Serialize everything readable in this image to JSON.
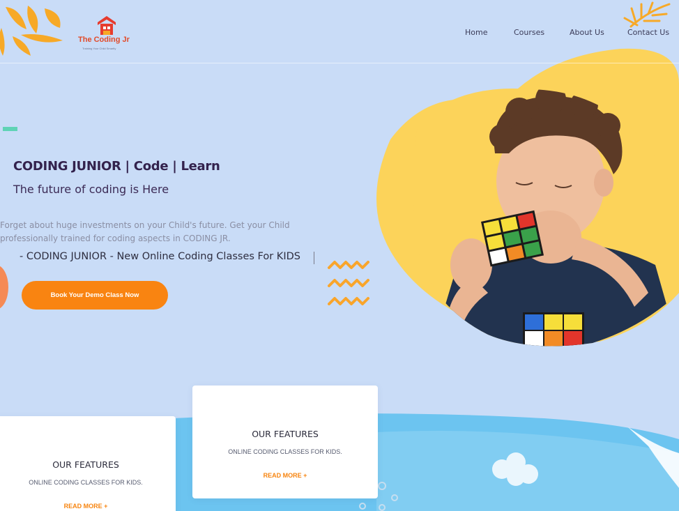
{
  "brand": {
    "name": "The Coding Jr",
    "tagline": "Training Your Child Smartly"
  },
  "nav": {
    "items": [
      {
        "label": "Home"
      },
      {
        "label": "Courses"
      },
      {
        "label": "About Us"
      },
      {
        "label": "Contact Us"
      }
    ]
  },
  "hero": {
    "heading": "CODING JUNIOR | Code | Learn",
    "subheading": "The future of coding is Here",
    "description": "Forget about huge investments on your Child's future. Get your Child professionally trained for coding aspects in CODING JR.",
    "tagline": "- CODING JUNIOR - New Online Coding Classes For KIDS",
    "cta_label": "Book Your Demo Class Now"
  },
  "features": [
    {
      "title": "OUR FEATURES",
      "text": "ONLINE CODING CLASSES FOR KIDS.",
      "link": "READ MORE +"
    },
    {
      "title": "OUR FEATURES",
      "text": "ONLINE CODING CLASSES FOR KIDS.",
      "link": "READ MORE +"
    }
  ],
  "colors": {
    "background": "#c9dcf7",
    "accent_orange": "#f98411",
    "accent_yellow": "#fcd35a",
    "sky_blue": "#6cc4f0",
    "heading": "#33224d",
    "teal_dash": "#5fd3b5"
  },
  "icons": {
    "logo": "house-cube-logo",
    "leaf": "palm-leaf",
    "wave": "zigzag-wave",
    "cloud": "cloud"
  }
}
